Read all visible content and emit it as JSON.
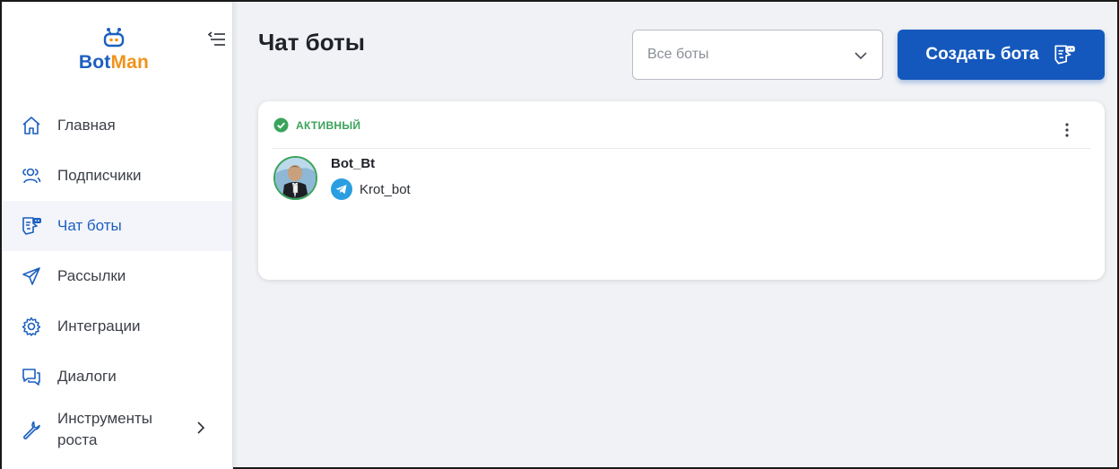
{
  "brand": {
    "name_part1": "Bot",
    "name_part2": "Man",
    "color_primary": "#1b5fbf",
    "color_accent": "#f0931c"
  },
  "sidebar": {
    "items": [
      {
        "label": "Главная",
        "icon": "home-icon",
        "active": false
      },
      {
        "label": "Подписчики",
        "icon": "users-icon",
        "active": false
      },
      {
        "label": "Чат боты",
        "icon": "chatbot-icon",
        "active": true
      },
      {
        "label": "Рассылки",
        "icon": "send-icon",
        "active": false
      },
      {
        "label": "Интеграции",
        "icon": "gear-icon",
        "active": false
      },
      {
        "label": "Диалоги",
        "icon": "dialogs-icon",
        "active": false
      },
      {
        "label": "Инструменты роста",
        "icon": "wrench-icon",
        "active": false,
        "expandable": true
      }
    ]
  },
  "header": {
    "title": "Чат боты",
    "filter_value": "Все боты",
    "create_button_label": "Создать бота"
  },
  "bots": [
    {
      "status": "АКТИВНЫЙ",
      "status_color": "#3aa35a",
      "name": "Bot_Bt",
      "platform": "telegram",
      "username": "Krot_bot"
    }
  ]
}
